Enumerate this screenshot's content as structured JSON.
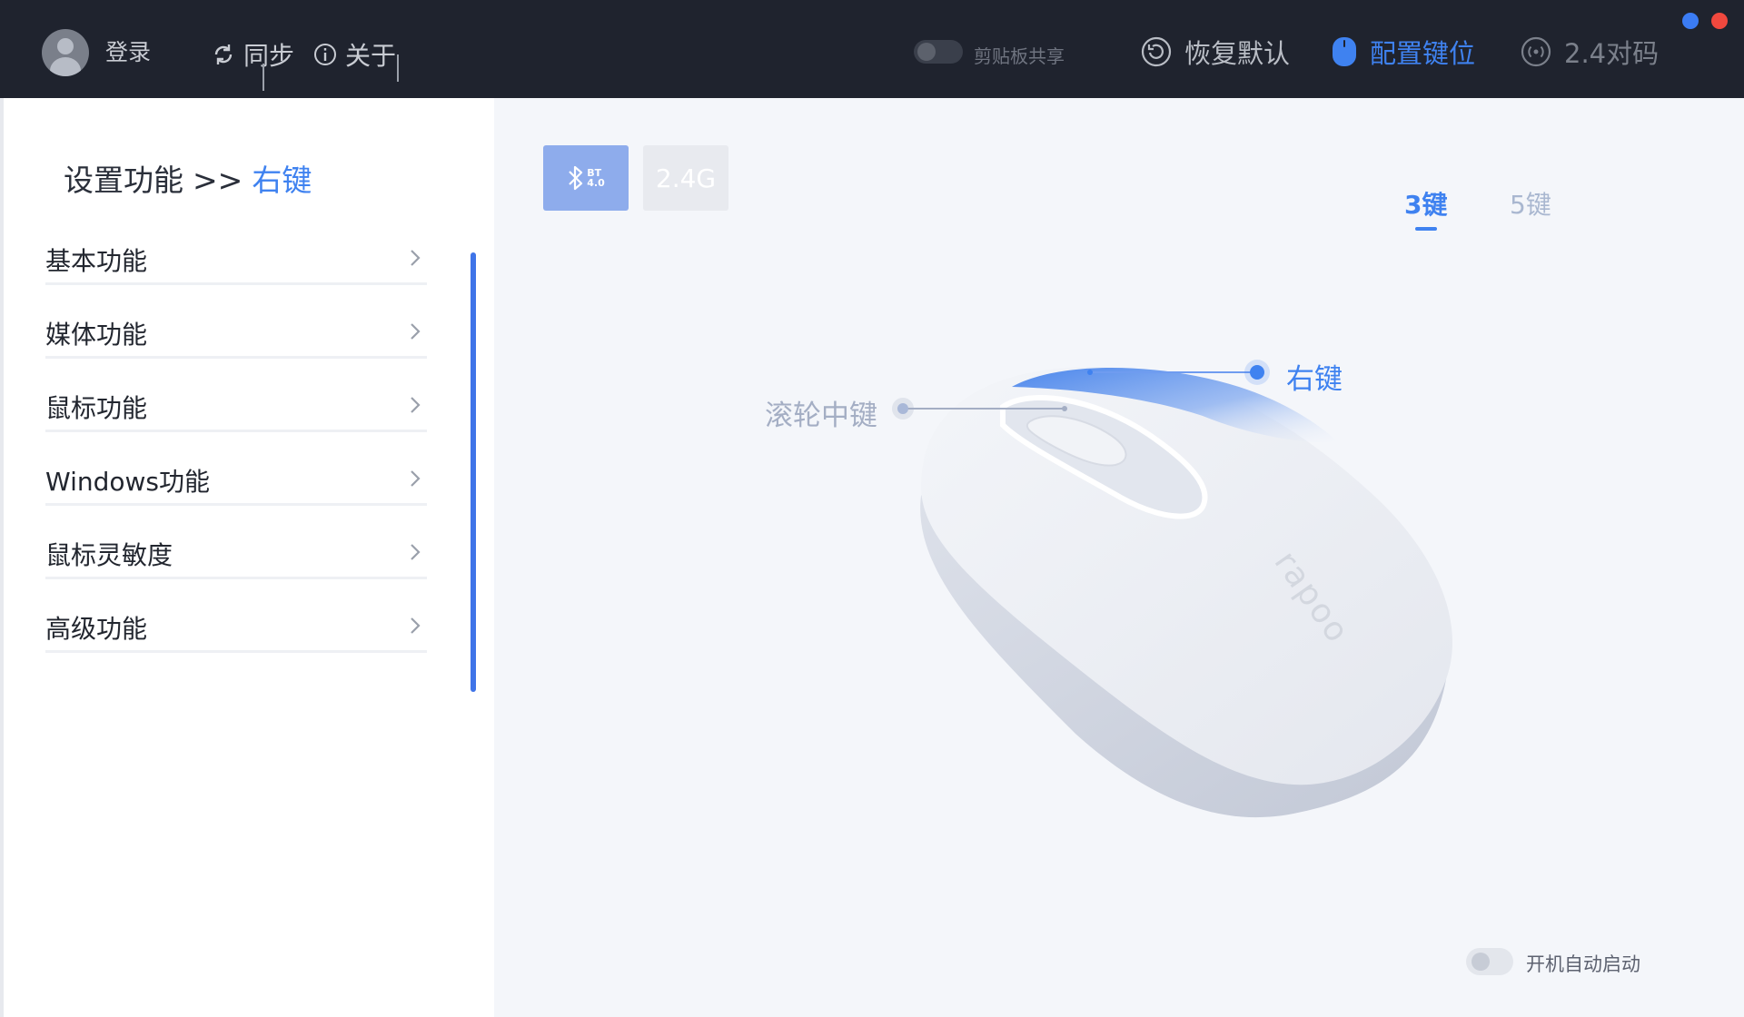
{
  "header": {
    "login_label": "登录",
    "sync_label": "同步",
    "about_label": "关于",
    "clipboard_label": "剪贴板共享",
    "clipboard_on": false,
    "restore_label": "恢复默认",
    "config_label": "配置键位",
    "pair_label": "2.4对码",
    "icons": {
      "sync": "refresh-icon",
      "about": "info-icon",
      "restore": "restore-icon",
      "config": "mouse-icon",
      "pair": "pairing-icon"
    }
  },
  "breadcrumb": {
    "parent": "设置功能",
    "separator": ">>",
    "current": "右键"
  },
  "menu": {
    "items": [
      {
        "label": "基本功能"
      },
      {
        "label": "媒体功能"
      },
      {
        "label": "鼠标功能"
      },
      {
        "label": "Windows功能"
      },
      {
        "label": "鼠标灵敏度"
      },
      {
        "label": "高级功能"
      }
    ]
  },
  "connection": {
    "bt_label": "BT 4.0",
    "bt_line1": "BT",
    "bt_line2": "4.0",
    "g24_label": "2.4G",
    "selected": "bt"
  },
  "keys": {
    "tab3": "3键",
    "tab5": "5键",
    "selected": "3键"
  },
  "mouse": {
    "right_button_label": "右键",
    "wheel_label": "滚轮中键",
    "brand": "rapoo"
  },
  "footer": {
    "autostart_label": "开机自动启动",
    "autostart_on": false
  },
  "colors": {
    "accent": "#3f82f0",
    "topbar": "#1f232e",
    "sidebar_bg": "#ffffff",
    "main_bg": "#f4f6fa",
    "window_dot_blue": "#3b7cf4",
    "window_dot_red": "#f0483e"
  }
}
